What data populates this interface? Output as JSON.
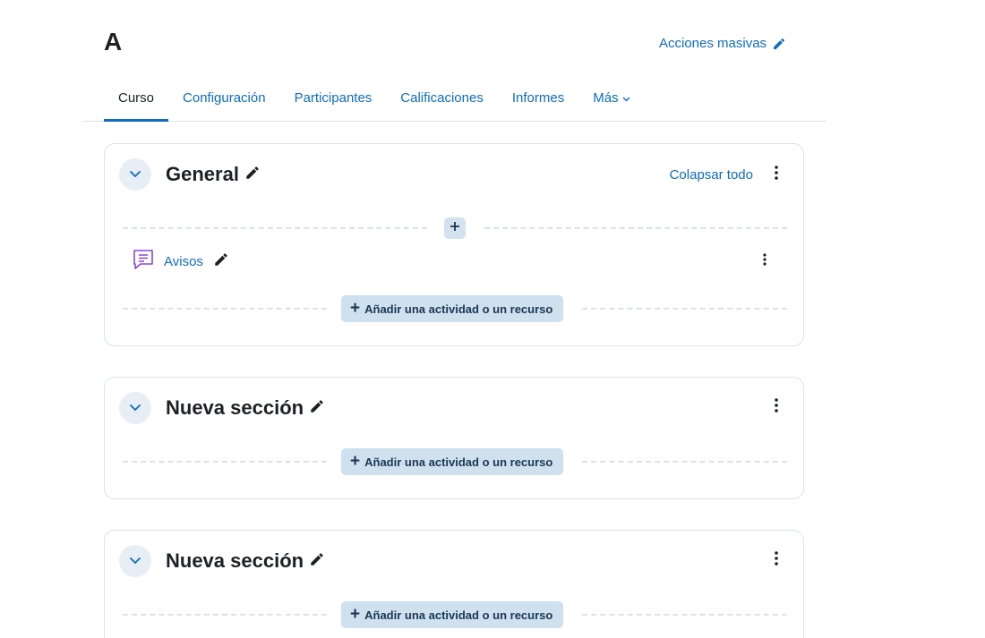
{
  "course": {
    "title": "A",
    "bulk_actions_label": "Acciones masivas"
  },
  "tabs": [
    {
      "label": "Curso",
      "active": true
    },
    {
      "label": "Configuración",
      "active": false
    },
    {
      "label": "Participantes",
      "active": false
    },
    {
      "label": "Calificaciones",
      "active": false
    },
    {
      "label": "Informes",
      "active": false
    },
    {
      "label": "Más",
      "active": false
    }
  ],
  "sections": [
    {
      "title": "General",
      "collapse_all_label": "Colapsar todo",
      "activities": [
        {
          "name": "Avisos",
          "icon": "forum-icon"
        }
      ],
      "add_label": "Añadir una actividad o un recurso"
    },
    {
      "title": "Nueva sección",
      "add_label": "Añadir una actividad o un recurso"
    },
    {
      "title": "Nueva sección",
      "add_label": "Añadir una actividad o un recurso"
    }
  ],
  "colors": {
    "link": "#0f6cbf",
    "text": "#1d2125",
    "add_button_bg": "#cfe0ef",
    "forum_icon": "#8f45d6"
  }
}
